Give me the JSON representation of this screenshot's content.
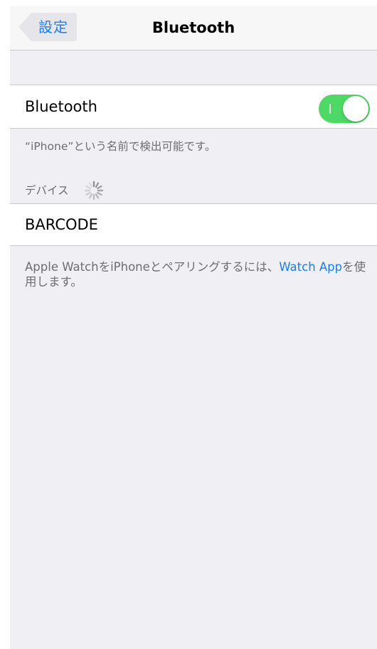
{
  "navbar": {
    "back_label": "設定",
    "title": "Bluetooth"
  },
  "bluetooth_cell": {
    "label": "Bluetooth",
    "toggle_on": true
  },
  "discoverable_note": "“iPhone”という名前で検出可能です。",
  "devices_section": {
    "header": "デバイス",
    "items": [
      {
        "name": "BARCODE"
      }
    ]
  },
  "footer": {
    "text_before": "Apple WatchをiPhoneとペアリングするには、",
    "link": "Watch App",
    "text_after": "を使用します。"
  },
  "colors": {
    "accent": "#157efb",
    "toggle_on": "#4cd964",
    "background": "#efeff4",
    "secondary_text": "#6d6d72"
  },
  "icons": {
    "back": "chevron-left-icon",
    "loading": "activity-spinner-icon"
  }
}
